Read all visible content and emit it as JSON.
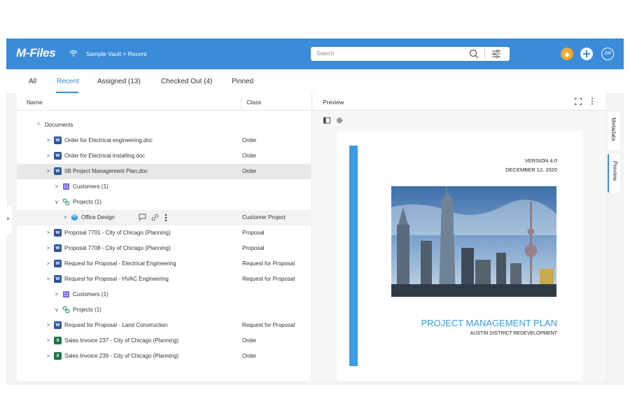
{
  "header": {
    "logo": "M-Files",
    "breadcrumb": "Sample Vault > Recent",
    "search_placeholder": "Search",
    "user_initials": "JW",
    "brand_color": "#3a8bd8"
  },
  "tabs": [
    {
      "label": "All"
    },
    {
      "label": "Recent",
      "active": true
    },
    {
      "label": "Assigned (13)"
    },
    {
      "label": "Checked Out (4)"
    },
    {
      "label": "Pinned"
    }
  ],
  "list": {
    "col_name": "Name",
    "col_class": "Class",
    "rows": [
      {
        "label": "Documents",
        "class": "",
        "icon": "none"
      },
      {
        "label": "Order for Electrical engineering.doc",
        "class": "Order",
        "icon": "word-icon"
      },
      {
        "label": "Order for Electrical installing.doc",
        "class": "Order",
        "icon": "word-icon"
      },
      {
        "label": "IIB Project Management Plan.doc",
        "class": "Order",
        "icon": "word-icon",
        "selected": true
      },
      {
        "label": "Customers (1)",
        "class": "",
        "icon": "building-icon"
      },
      {
        "label": "Projects (1)",
        "class": "",
        "icon": "projects-icon"
      },
      {
        "label": "Office Design",
        "class": "Customer Project",
        "icon": "cube-icon"
      },
      {
        "label": "Proposal 7701 - City of Chicago (Planning)",
        "class": "Proposal",
        "icon": "word-icon"
      },
      {
        "label": "Proposal 7708 - City of Chicago (Planning)",
        "class": "Proposal",
        "icon": "word-icon"
      },
      {
        "label": "Request for Proposal - Electrical Engineering",
        "class": "Request for Proposal",
        "icon": "word-icon"
      },
      {
        "label": "Request for Proposal - HVAC Engineering",
        "class": "Request for Proposal",
        "icon": "word-icon"
      },
      {
        "label": "Customers (1)",
        "class": "",
        "icon": "building-icon"
      },
      {
        "label": "Projects (1)",
        "class": "",
        "icon": "projects-icon"
      },
      {
        "label": "Request for Proposal - Land Construction",
        "class": "Request for Proposal",
        "icon": "word-icon"
      },
      {
        "label": "Sales Invoice 237 - City of Chicago (Planning)",
        "class": "Order",
        "icon": "excel-icon"
      },
      {
        "label": "Sales Invoice 239 - City of Chicago (Planning)",
        "class": "Order",
        "icon": "excel-icon"
      }
    ],
    "icon_letters": {
      "word": "W",
      "excel": "X"
    }
  },
  "preview": {
    "title": "Preview",
    "doc_version": "VERSION 4.0",
    "doc_date": "DECEMBER 12, 2020",
    "doc_title": "PROJECT MANAGEMENT PLAN",
    "doc_subtitle": "AUSTIN DISTRICT REDEVELOPMENT",
    "accent_color": "#3b9be0"
  },
  "side_tabs": {
    "metadata": "Metadata",
    "preview": "Preview"
  }
}
